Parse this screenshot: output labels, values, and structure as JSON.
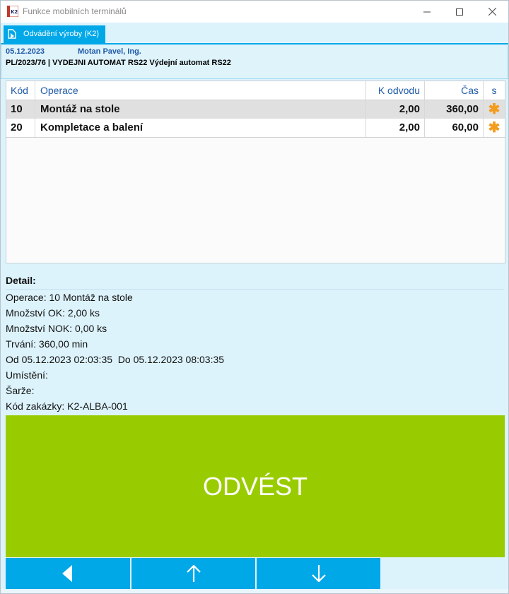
{
  "window": {
    "title": "Funkce mobilních terminálů",
    "controls": [
      "minimize-icon",
      "maximize-icon",
      "close-icon"
    ]
  },
  "tab": {
    "label": "Odvádění výroby (K2)"
  },
  "header": {
    "date": "05.12.2023",
    "user": "Motan Pavel, Ing.",
    "document": "PL/2023/76 | VYDEJNI AUTOMAT RS22 Výdejní automat RS22"
  },
  "grid": {
    "columns": {
      "kod": "Kód",
      "operace": "Operace",
      "k_odvodu": "K odvodu",
      "cas": "Čas",
      "s": "s"
    },
    "rows": [
      {
        "kod": "10",
        "operace": "Montáž na stole",
        "k_odvodu": "2,00",
        "cas": "360,00",
        "s": "✱"
      },
      {
        "kod": "20",
        "operace": "Kompletace a balení",
        "k_odvodu": "2,00",
        "cas": "60,00",
        "s": "✱"
      }
    ],
    "selected_row": 0
  },
  "detail": {
    "title": "Detail:",
    "lines": [
      "Operace: 10 Montáž na stole",
      "Množství OK: 2,00 ks",
      "Množství NOK: 0,00 ks",
      "Trvání: 360,00 min",
      "Od 05.12.2023 02:03:35  Do 05.12.2023 08:03:35",
      "Umístění:",
      "Šarže:",
      "Kód zakázky: K2-ALBA-001"
    ]
  },
  "action_button": {
    "label": "ODVÉST",
    "color": "#99cc00"
  },
  "nav": {
    "buttons": [
      "back-arrow-icon",
      "up-arrow-icon",
      "down-arrow-icon"
    ]
  },
  "colors": {
    "accent": "#00a8e8",
    "header_text": "#1f5aa8",
    "star": "#f39c1e"
  }
}
